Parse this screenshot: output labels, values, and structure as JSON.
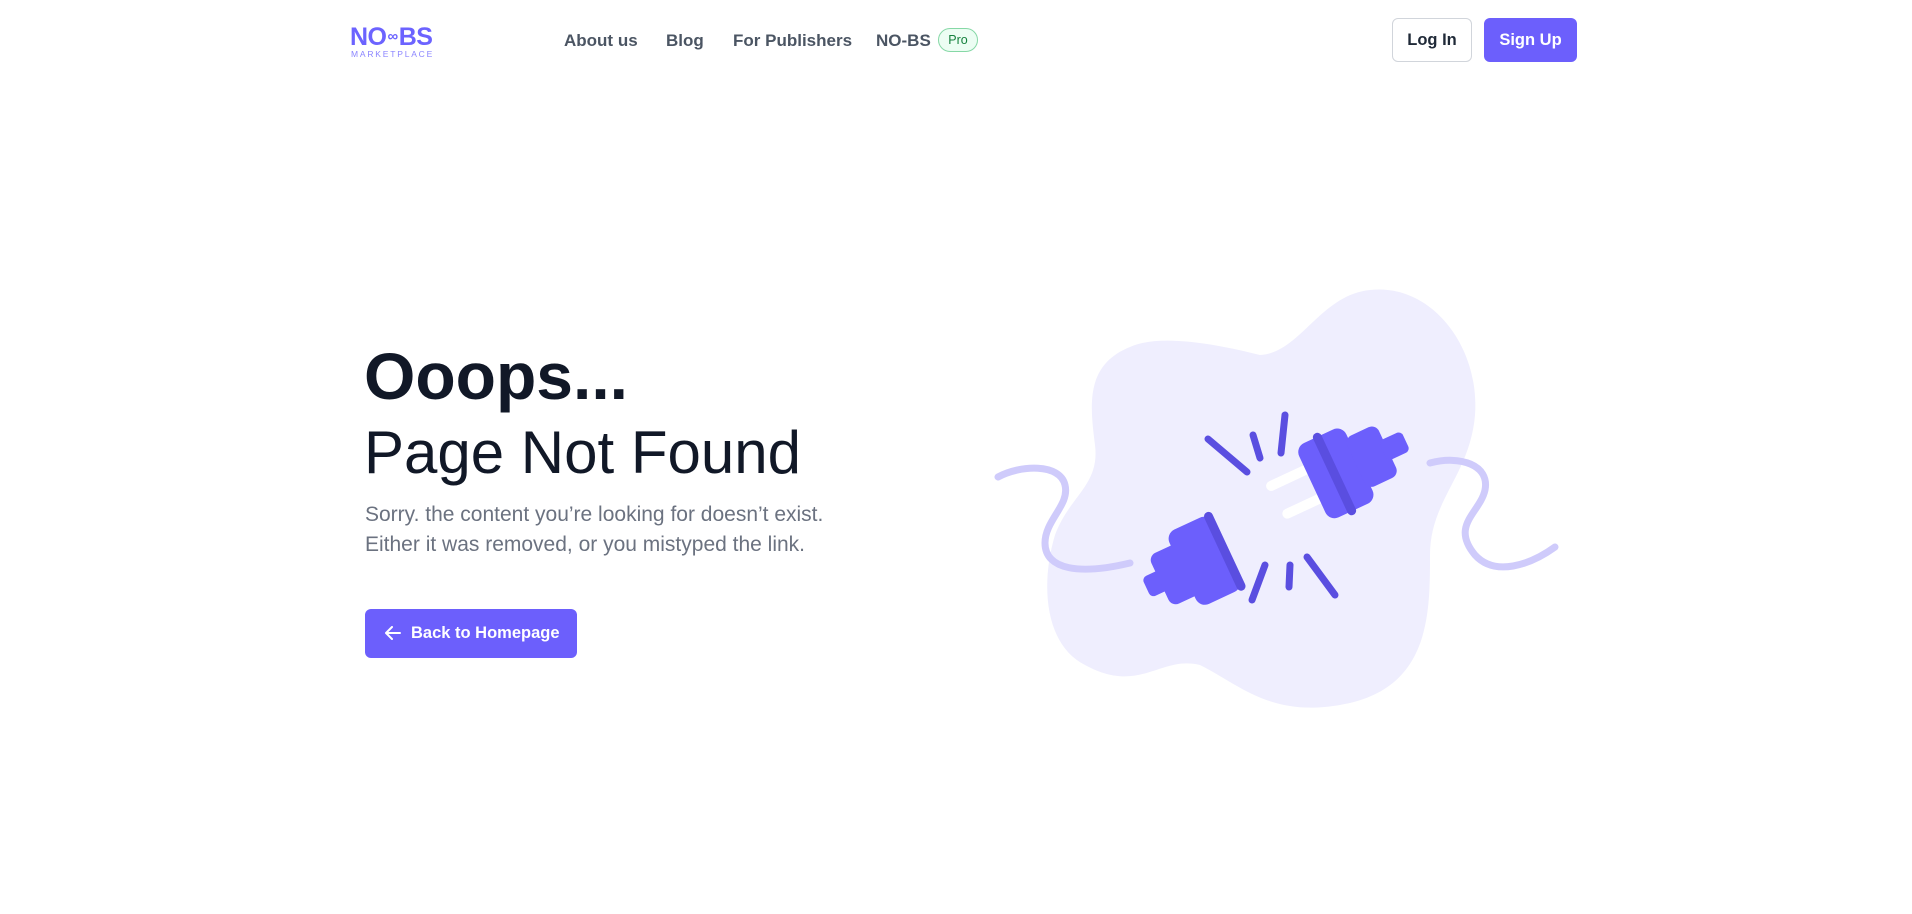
{
  "brand": {
    "logo_main_left": "NO",
    "logo_main_right": "BS",
    "logo_sub": "MARKETPLACE",
    "accent": "#6c5ffc"
  },
  "nav": {
    "items": [
      {
        "label": "About us"
      },
      {
        "label": "Blog"
      },
      {
        "label": "For Publishers"
      },
      {
        "label": "NO-BS"
      }
    ],
    "pro_badge": "Pro"
  },
  "auth": {
    "login_label": "Log In",
    "signup_label": "Sign Up"
  },
  "error": {
    "title": "Ooops...",
    "subtitle": "Page Not Found",
    "description_line1": "Sorry. the content you’re looking for doesn’t exist.",
    "description_line2": "Either it was removed, or you mistyped the link.",
    "back_button_label": "Back to Homepage"
  },
  "illustration": {
    "name": "unplugged-cable-illustration",
    "blob_color": "#efeefe",
    "plug_color": "#6c5ffc",
    "cable_color": "#cfcbfb"
  }
}
